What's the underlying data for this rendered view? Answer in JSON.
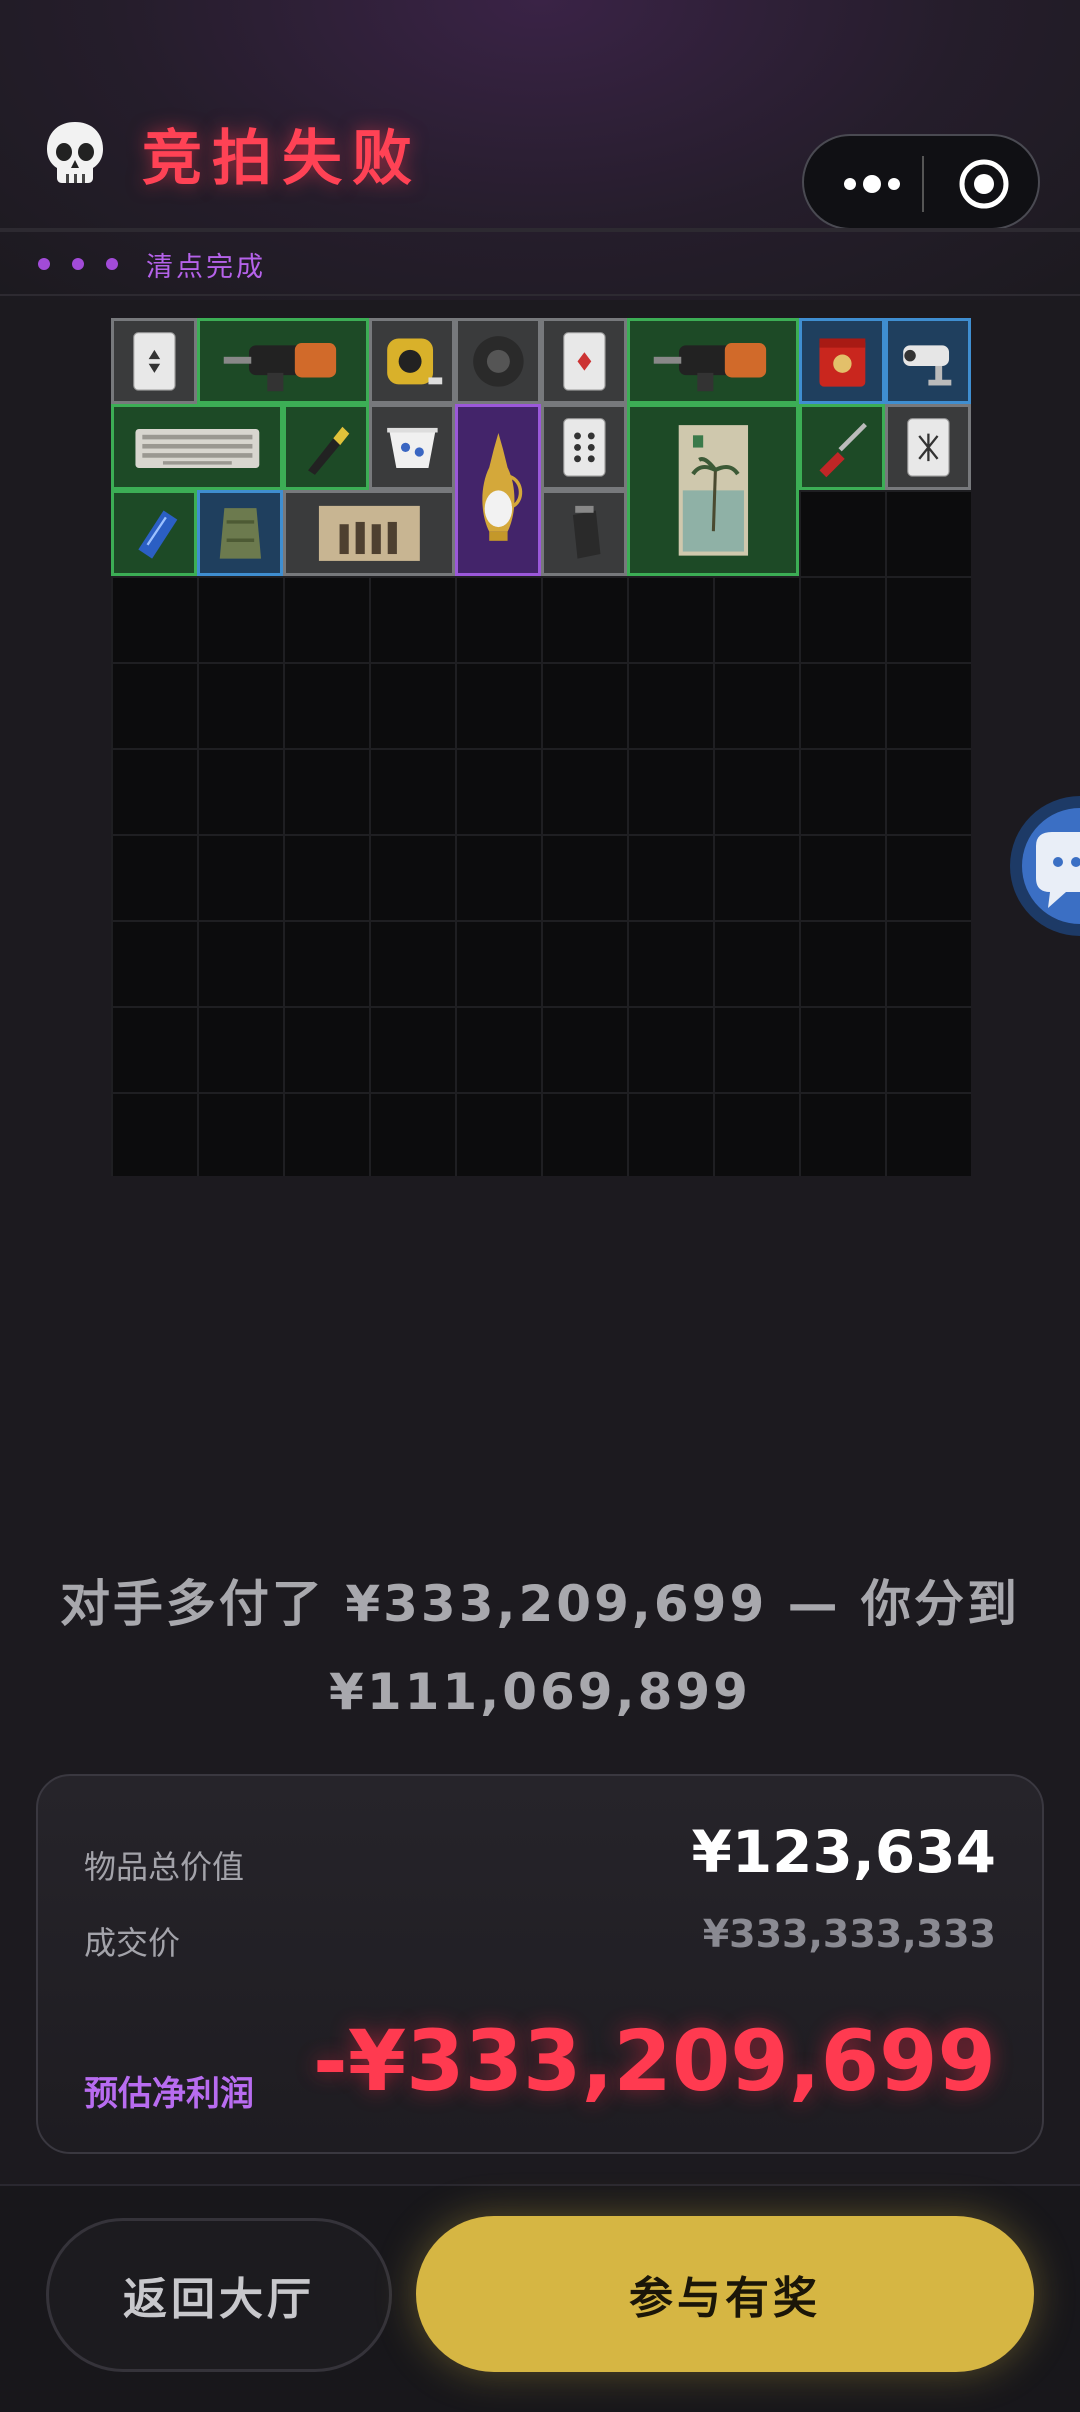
{
  "header": {
    "title": "竞拍失败",
    "status_text": "清点完成"
  },
  "inventory": {
    "grid_cols": 10,
    "grid_rows": 10,
    "items": [
      {
        "name": "playing-card-item",
        "icon": "card-icon",
        "rarity": "gray"
      },
      {
        "name": "power-drill-item",
        "icon": "drill-icon",
        "rarity": "green"
      },
      {
        "name": "tape-measure-item",
        "icon": "tape-measure-icon",
        "rarity": "gray"
      },
      {
        "name": "duct-tape-item",
        "icon": "tape-roll-icon",
        "rarity": "gray"
      },
      {
        "name": "playing-card-item",
        "icon": "card-icon",
        "rarity": "gray"
      },
      {
        "name": "power-drill-item",
        "icon": "drill-icon",
        "rarity": "green"
      },
      {
        "name": "tea-tin-item",
        "icon": "tin-icon",
        "rarity": "blue"
      },
      {
        "name": "security-camera-item",
        "icon": "camera-icon",
        "rarity": "blue"
      },
      {
        "name": "keyboard-item",
        "icon": "keyboard-icon",
        "rarity": "green"
      },
      {
        "name": "test-pen-item",
        "icon": "pen-icon",
        "rarity": "green"
      },
      {
        "name": "porcelain-cup-item",
        "icon": "cup-icon",
        "rarity": "gray"
      },
      {
        "name": "golden-ewer-item",
        "icon": "ewer-icon",
        "rarity": "purple"
      },
      {
        "name": "playing-card-item",
        "icon": "card-icon",
        "rarity": "gray"
      },
      {
        "name": "travel-poster-item",
        "icon": "poster-icon",
        "rarity": "green"
      },
      {
        "name": "screwdriver-item",
        "icon": "screwdriver-icon",
        "rarity": "green"
      },
      {
        "name": "playing-card-item",
        "icon": "card-icon",
        "rarity": "gray"
      },
      {
        "name": "soda-can-item",
        "icon": "can-icon",
        "rarity": "green"
      },
      {
        "name": "ration-pack-item",
        "icon": "pack-icon",
        "rarity": "blue"
      },
      {
        "name": "old-photo-item",
        "icon": "photo-icon",
        "rarity": "gray"
      },
      {
        "name": "pepper-grinder-item",
        "icon": "grinder-icon",
        "rarity": "gray"
      }
    ]
  },
  "message": {
    "line1": "对手多付了 ¥333,209,699 — 你分到",
    "line2": "¥111,069,899"
  },
  "summary": {
    "total_value_label": "物品总价值",
    "total_value": "¥123,634",
    "deal_price_label": "成交价",
    "deal_price": "¥333,333,333",
    "profit_label": "预估净利润",
    "profit": "-¥333,209,699"
  },
  "buttons": {
    "back_label": "返回大厅",
    "prize_label": "参与有奖"
  },
  "colors": {
    "title_red": "#ff4255",
    "accent_purple": "#b562ea",
    "gold": "#d6b643",
    "rarity_gray": "#77797c",
    "rarity_green": "#3cae55",
    "rarity_blue": "#3f8ed0",
    "rarity_purple": "#9b58da"
  }
}
